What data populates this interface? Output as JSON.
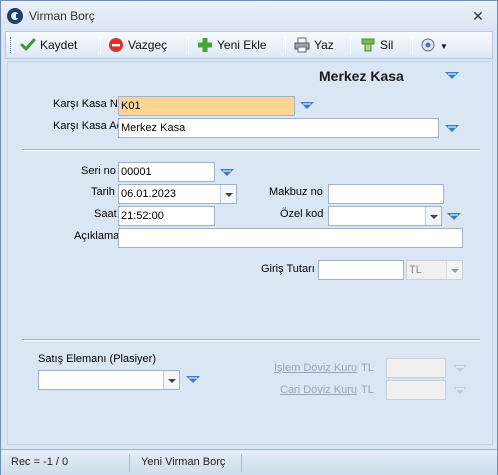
{
  "window": {
    "title": "Virman Borç"
  },
  "toolbar": {
    "save_label": "Kaydet",
    "cancel_label": "Vazgeç",
    "new_label": "Yeni Ekle",
    "print_label": "Yaz",
    "delete_label": "Sil"
  },
  "header": {
    "title": "Merkez Kasa"
  },
  "form": {
    "karsi_kasa_no_label": "Karşı Kasa No",
    "karsi_kasa_no_value": "K01",
    "karsi_kasa_adi_label": "Karşı Kasa Adı",
    "karsi_kasa_adi_value": "Merkez Kasa",
    "seri_no_label": "Seri no",
    "seri_no_value": "00001",
    "tarih_label": "Tarih",
    "tarih_value": "06.01.2023",
    "makbuz_no_label": "Makbuz no",
    "makbuz_no_value": "",
    "saat_label": "Saat",
    "saat_value": "21:52:00",
    "ozel_kod_label": "Özel kod",
    "ozel_kod_value": "",
    "aciklama_label": "Açıklama",
    "aciklama_value": "",
    "giris_tutari_label": "Giriş Tutarı",
    "giris_tutari_value": "",
    "currency_value": "TL",
    "satis_elemani_label": "Satış Elemanı (Plasiyer)",
    "satis_elemani_value": "",
    "islem_doviz_kuru_label": "İşlem Döviz Kuru",
    "islem_doviz_currency": "TL",
    "islem_doviz_value": "",
    "cari_doviz_kuru_label": "Cari Döviz Kuru",
    "cari_doviz_currency": "TL",
    "cari_doviz_value": ""
  },
  "status": {
    "record_text": "Rec = -1 / 0",
    "mode_text": "Yeni Virman Borç"
  }
}
